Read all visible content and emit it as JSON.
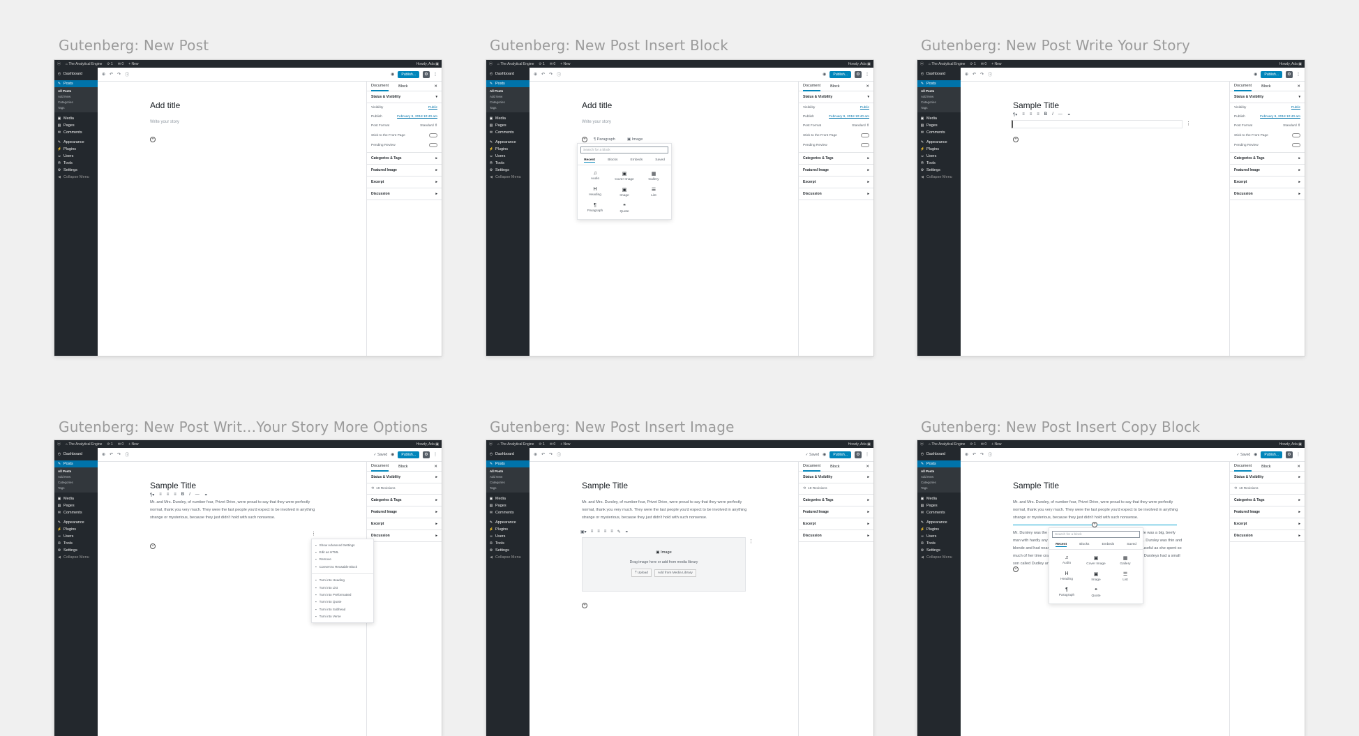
{
  "captions": [
    "Gutenberg: New Post",
    "Gutenberg: New Post Insert Block",
    "Gutenberg: New Post Write Your Story",
    "Gutenberg: New Post Writ…Your Story More Options",
    "Gutenberg: New Post Insert Image",
    "Gutenberg: New Post Insert Copy Block"
  ],
  "adminbar": {
    "wp_icon": "wordpress-logo-icon",
    "site": "The Analytical Engine",
    "updates": "1",
    "comments": "0",
    "new": "+ New",
    "howdy": "Howdy, Ada"
  },
  "sidebar": {
    "dashboard": "Dashboard",
    "posts": "Posts",
    "posts_sub": [
      "All Posts",
      "Add New",
      "Categories",
      "Tags"
    ],
    "media": "Media",
    "pages": "Pages",
    "comments": "Comments",
    "appearance": "Appearance",
    "plugins": "Plugins",
    "users": "Users",
    "tools": "Tools",
    "settings": "Settings",
    "collapse": "Collapse Menu"
  },
  "toolbar": {
    "saved": "Saved",
    "publish": "Publish..."
  },
  "settings": {
    "tab_document": "Document",
    "tab_block": "Block",
    "status_visibility": "Status & Visibility",
    "visibility_label": "Visibility",
    "visibility_value": "Public",
    "publish_label": "Publish",
    "publish_value": "February 9, 2018 10:40 am",
    "post_format_label": "Post Format",
    "post_format_value": "Standard",
    "stick_front": "Stick to the Front Page",
    "pending_review": "Pending Review",
    "revisions": "19 Revisions",
    "categories_tags": "Categories & Tags",
    "featured_image": "Featured Image",
    "excerpt": "Excerpt",
    "discussion": "Discussion"
  },
  "editor": {
    "add_title": "Add title",
    "write_story": "Write your story",
    "sample_title": "Sample Title",
    "paragraph": "Mr. and Mrs. Dursley, of number four, Privet Drive, were proud to say that they were perfectly normal, thank you very much. They were the last people you'd expect to be involved in anything strange or mysterious, because they just didn't hold with such nonsense.",
    "paragraph2": "Mr. Dursley was the director of a firm called Grunnings, which made drills. He was a big, beefy man with hardly any neck, although he did have a very large mustache. Mrs. Dursley was thin and blonde and had nearly twice the usual amount of neck, which came in very useful as she spent so much of her time craning over garden fences, spying on the neighbors. The Dursleys had a small son called Dudley and in their opinion there was no finer boy anywhere."
  },
  "quick_blocks": {
    "paragraph": "Paragraph",
    "image": "Image"
  },
  "inserter": {
    "search_placeholder": "Search for a block",
    "tabs": [
      "Recent",
      "Blocks",
      "Embeds",
      "Saved"
    ],
    "blocks": [
      {
        "label": "Audio",
        "icon": "♫"
      },
      {
        "label": "Cover Image",
        "icon": "▣"
      },
      {
        "label": "Gallery",
        "icon": "▦"
      },
      {
        "label": "Heading",
        "icon": "H"
      },
      {
        "label": "Image",
        "icon": "▣"
      },
      {
        "label": "List",
        "icon": "☰"
      },
      {
        "label": "Paragraph",
        "icon": "¶"
      },
      {
        "label": "Quote",
        "icon": "❝"
      }
    ]
  },
  "more_menu": {
    "items_top": [
      "Show Advanced Settings",
      "Edit as HTML",
      "Remove",
      "Convert to Reusable Block"
    ],
    "items_bottom": [
      "Turn into Heading",
      "Turn into List",
      "Turn into Preformatted",
      "Turn into Quote",
      "Turn into Subhead",
      "Turn into Verse"
    ]
  },
  "image_block": {
    "title": "Image",
    "desc": "Drag image here or add from media library",
    "upload": "Upload",
    "media_library": "Add from Media Library"
  }
}
